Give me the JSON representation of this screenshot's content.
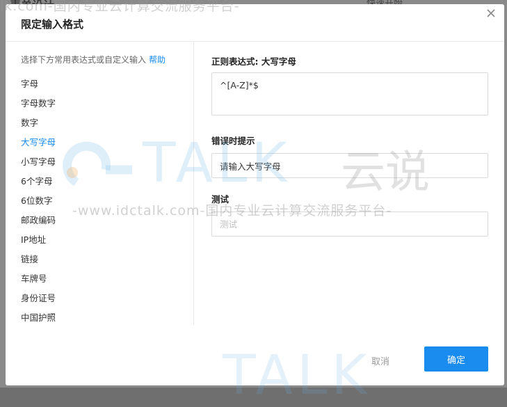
{
  "background": {
    "page_title": "表单设计",
    "right_text": "快速开始"
  },
  "watermark": {
    "url_line": "-www.idctalk.com-国内专业云计算交流服务平台-",
    "top_line": "lk.com-国内专业云计算交流服务平台-",
    "brand": "TALK",
    "brand_cn": "云说"
  },
  "dialog": {
    "title": "限定输入格式",
    "close_icon": "close-icon"
  },
  "presets": {
    "hint": "选择下方常用表达式或自定义输入",
    "help_label": "帮助",
    "items": [
      {
        "label": "字母",
        "active": false
      },
      {
        "label": "字母数字",
        "active": false
      },
      {
        "label": "数字",
        "active": false
      },
      {
        "label": "大写字母",
        "active": true
      },
      {
        "label": "小写字母",
        "active": false
      },
      {
        "label": "6个字母",
        "active": false
      },
      {
        "label": "6位数字",
        "active": false
      },
      {
        "label": "邮政编码",
        "active": false
      },
      {
        "label": "IP地址",
        "active": false
      },
      {
        "label": "链接",
        "active": false
      },
      {
        "label": "车牌号",
        "active": false
      },
      {
        "label": "身份证号",
        "active": false
      },
      {
        "label": "中国护照",
        "active": false
      }
    ]
  },
  "regex": {
    "label": "正则表达式: 大写字母",
    "value": "^[A-Z]*$"
  },
  "error_hint": {
    "label": "错误时提示",
    "value": "请输入大写字母"
  },
  "test": {
    "label": "测试",
    "placeholder": "测试"
  },
  "footer": {
    "cancel_label": "取消",
    "ok_label": "确定"
  },
  "colors": {
    "accent": "#1a8cf0",
    "overlay": "#8a8a8a"
  }
}
